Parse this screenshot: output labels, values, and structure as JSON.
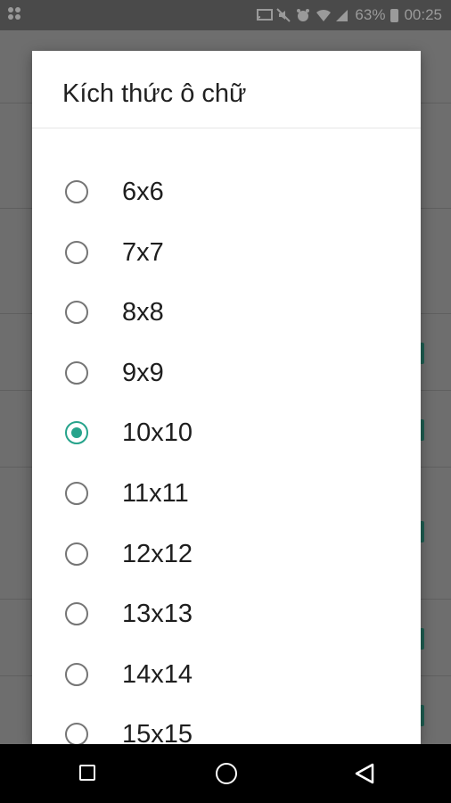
{
  "status_bar": {
    "battery_percent": "63%",
    "time": "00:25",
    "icons": [
      "app-grid-icon",
      "cast-icon",
      "mute-icon",
      "alarm-icon",
      "wifi-icon",
      "signal-icon",
      "battery-icon"
    ]
  },
  "dialog": {
    "title": "Kích thức ô chữ",
    "options": [
      {
        "label": "6x6",
        "selected": false
      },
      {
        "label": "7x7",
        "selected": false
      },
      {
        "label": "8x8",
        "selected": false
      },
      {
        "label": "9x9",
        "selected": false
      },
      {
        "label": "10x10",
        "selected": true
      },
      {
        "label": "11x11",
        "selected": false
      },
      {
        "label": "12x12",
        "selected": false
      },
      {
        "label": "13x13",
        "selected": false
      },
      {
        "label": "14x14",
        "selected": false
      },
      {
        "label": "15x15",
        "selected": false
      }
    ],
    "accent_color": "#26a38b"
  },
  "navigation_bar": {
    "buttons": [
      "recents-icon",
      "home-icon",
      "back-icon"
    ]
  }
}
